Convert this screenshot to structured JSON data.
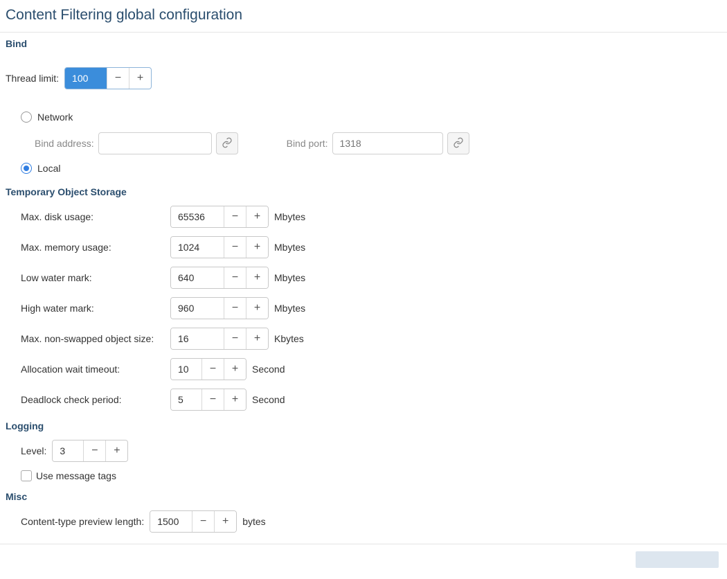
{
  "page_title": "Content Filtering global configuration",
  "bind": {
    "heading": "Bind",
    "thread_limit_label": "Thread limit:",
    "thread_limit_value": "100",
    "network_label": "Network",
    "local_label": "Local",
    "bind_address_label": "Bind address:",
    "bind_address_value": "",
    "bind_port_label": "Bind port:",
    "bind_port_placeholder": "1318"
  },
  "tos": {
    "heading": "Temporary Object Storage",
    "fields": [
      {
        "label": "Max. disk usage:",
        "value": "65536",
        "unit": "Mbytes"
      },
      {
        "label": "Max. memory usage:",
        "value": "1024",
        "unit": "Mbytes"
      },
      {
        "label": "Low water mark:",
        "value": "640",
        "unit": "Mbytes"
      },
      {
        "label": "High water mark:",
        "value": "960",
        "unit": "Mbytes"
      },
      {
        "label": "Max. non-swapped object size:",
        "value": "16",
        "unit": "Kbytes"
      },
      {
        "label": "Allocation wait timeout:",
        "value": "10",
        "unit": "Second"
      },
      {
        "label": "Deadlock check period:",
        "value": "5",
        "unit": "Second"
      }
    ]
  },
  "logging": {
    "heading": "Logging",
    "level_label": "Level:",
    "level_value": "3",
    "use_tags_label": "Use message tags"
  },
  "misc": {
    "heading": "Misc",
    "preview_label": "Content-type preview length:",
    "preview_value": "1500",
    "preview_unit": "bytes"
  },
  "glyph": {
    "minus": "−",
    "plus": "+"
  }
}
